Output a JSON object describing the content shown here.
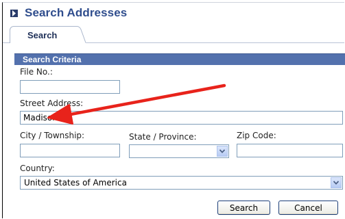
{
  "header": {
    "title": "Search Addresses",
    "icon": "chevron-right-icon"
  },
  "tabs": [
    {
      "label": "Search",
      "active": true
    }
  ],
  "section": {
    "title": "Search Criteria"
  },
  "form": {
    "file_no": {
      "label": "File No.:",
      "value": ""
    },
    "street_address": {
      "label": "Street Address:",
      "value": "Madison"
    },
    "city": {
      "label": "City / Township:",
      "value": ""
    },
    "state": {
      "label": "State / Province:",
      "value": ""
    },
    "zip": {
      "label": "Zip Code:",
      "value": ""
    },
    "country": {
      "label": "Country:",
      "value": "United States of America"
    }
  },
  "buttons": {
    "search": "Search",
    "cancel": "Cancel"
  },
  "annotation": {
    "type": "red-arrow",
    "color": "#e8231b"
  },
  "colors": {
    "title": "#2f4d8d",
    "section_bar": "#5371ad",
    "input_border": "#7f9db9"
  }
}
